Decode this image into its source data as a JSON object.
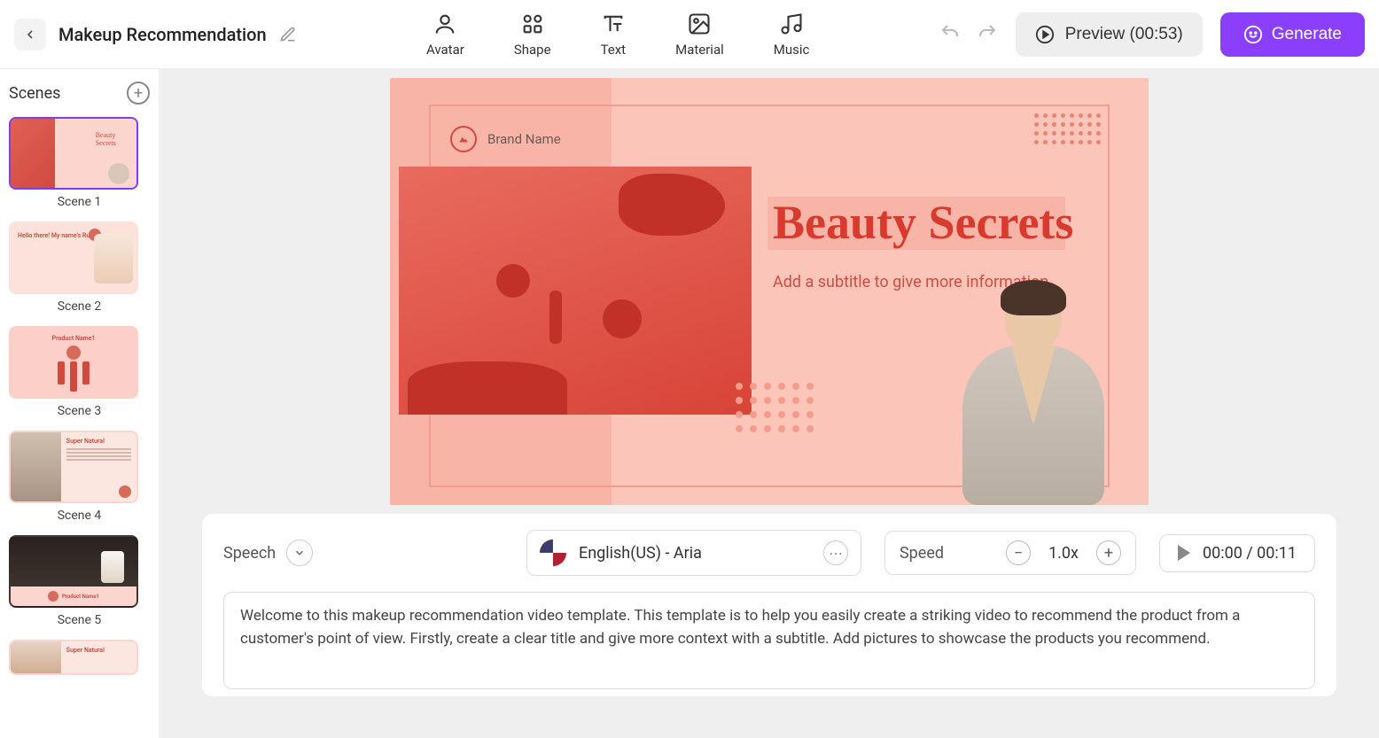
{
  "header": {
    "title": "Makeup Recommendation"
  },
  "toolbar": {
    "avatar": "Avatar",
    "shape": "Shape",
    "text": "Text",
    "material": "Material",
    "music": "Music",
    "preview": "Preview (00:53)",
    "generate": "Generate"
  },
  "sidebar": {
    "title": "Scenes",
    "scenes": [
      {
        "label": "Scene 1",
        "thumb_title": "Beauty Secrets"
      },
      {
        "label": "Scene 2",
        "thumb_title": "Hello there! My name's Ruby."
      },
      {
        "label": "Scene 3",
        "thumb_title": "Product Name1"
      },
      {
        "label": "Scene 4",
        "thumb_title": "Super Natural"
      },
      {
        "label": "Scene 5",
        "thumb_title": "Product Name1"
      },
      {
        "label": "",
        "thumb_title": "Super Natural"
      }
    ]
  },
  "canvas": {
    "brand_name": "Brand Name",
    "headline": "Beauty Secrets",
    "subtitle": "Add a subtitle to give more information"
  },
  "speech": {
    "label": "Speech",
    "voice": "English(US) - Aria",
    "speed_label": "Speed",
    "speed_value": "1.0x",
    "time": "00:00 / 00:11",
    "text": "Welcome to this makeup recommendation video template. This template is to help you easily create a striking video to recommend the product from a customer's point of view. Firstly, create a clear title and give more context with a subtitle. Add pictures to showcase the products you recommend."
  }
}
